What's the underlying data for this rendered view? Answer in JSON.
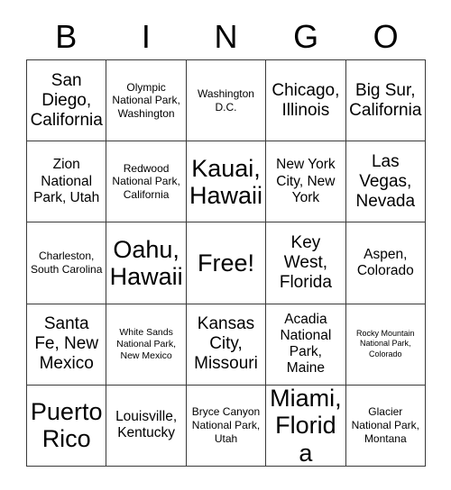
{
  "header": {
    "letters": [
      "B",
      "I",
      "N",
      "G",
      "O"
    ]
  },
  "grid": {
    "columns": 5,
    "rows": 5,
    "cells": [
      {
        "text": "San Diego, California",
        "size": "fs-lg",
        "free": false
      },
      {
        "text": "Olympic National Park, Washington",
        "size": "fs-sm",
        "free": false
      },
      {
        "text": "Washington D.C.",
        "size": "fs-sm",
        "free": false
      },
      {
        "text": "Chicago, Illinois",
        "size": "fs-lg",
        "free": false
      },
      {
        "text": "Big Sur, California",
        "size": "fs-lg",
        "free": false
      },
      {
        "text": "Zion National Park, Utah",
        "size": "fs-md",
        "free": false
      },
      {
        "text": "Redwood National Park, California",
        "size": "fs-sm",
        "free": false
      },
      {
        "text": "Kauai, Hawaii",
        "size": "fs-xl",
        "free": false
      },
      {
        "text": "New York City, New York",
        "size": "fs-md",
        "free": false
      },
      {
        "text": "Las Vegas, Nevada",
        "size": "fs-lg",
        "free": false
      },
      {
        "text": "Charleston, South Carolina",
        "size": "fs-sm",
        "free": false
      },
      {
        "text": "Oahu, Hawaii",
        "size": "fs-xl",
        "free": false
      },
      {
        "text": "Free!",
        "size": "fs-xl",
        "free": true
      },
      {
        "text": "Key West, Florida",
        "size": "fs-lg",
        "free": false
      },
      {
        "text": "Aspen, Colorado",
        "size": "fs-md",
        "free": false
      },
      {
        "text": "Santa Fe, New Mexico",
        "size": "fs-lg",
        "free": false
      },
      {
        "text": "White Sands National Park, New Mexico",
        "size": "fs-xs",
        "free": false
      },
      {
        "text": "Kansas City, Missouri",
        "size": "fs-lg",
        "free": false
      },
      {
        "text": "Acadia National Park, Maine",
        "size": "fs-md",
        "free": false
      },
      {
        "text": "Rocky Mountain National Park, Colorado",
        "size": "fs-xxs",
        "free": false
      },
      {
        "text": "Puerto Rico",
        "size": "fs-xl",
        "free": false
      },
      {
        "text": "Louisville, Kentucky",
        "size": "fs-md",
        "free": false
      },
      {
        "text": "Bryce Canyon National Park, Utah",
        "size": "fs-sm",
        "free": false
      },
      {
        "text": "Miami, Florida",
        "size": "fs-xl",
        "free": false
      },
      {
        "text": "Glacier National Park, Montana",
        "size": "fs-sm",
        "free": false
      }
    ]
  },
  "colors": {
    "background": "#ffffff",
    "border": "#3a3a3a",
    "text": "#000000"
  }
}
